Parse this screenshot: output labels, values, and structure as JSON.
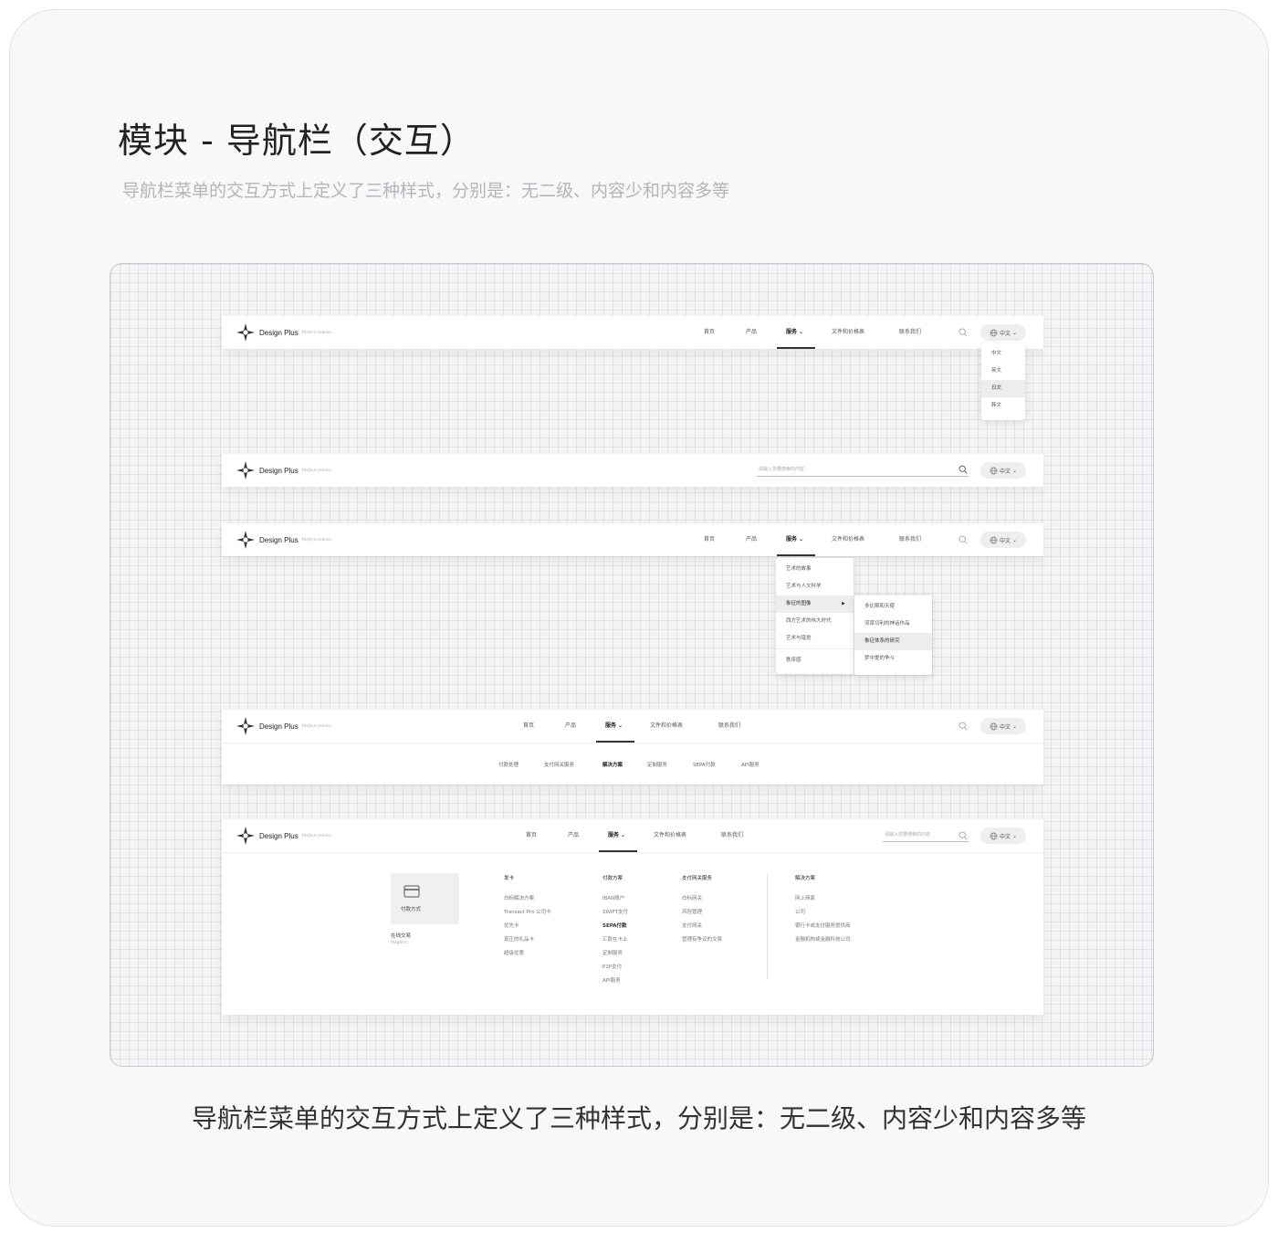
{
  "page": {
    "title": "模块 - 导航栏（交互）",
    "subtitle": "导航栏菜单的交互方式上定义了三种样式，分别是：无二级、内容少和内容多等",
    "caption": "导航栏菜单的交互方式上定义了三种样式，分别是：无二级、内容少和内容多等"
  },
  "brand": {
    "name": "Design Plus",
    "tagline": "Perfect creation"
  },
  "nav": {
    "items": [
      "首页",
      "产品",
      "服务",
      "文件和价格表",
      "联系我们"
    ],
    "lang": "中文",
    "search_placeholder": "请输入您要搜索的内容"
  },
  "lang_menu": [
    "中文",
    "英文",
    "日文",
    "韩文"
  ],
  "service_menu": [
    "艺术的故事",
    "艺术与人文科学",
    "象征的图像",
    "西方艺术的伟大时代",
    "艺术与错觉",
    "秩序感"
  ],
  "service_submenu": [
    "多比斯和天使",
    "流草切利的神话作品",
    "象征体系的研究",
    "梦中爱的争斗"
  ],
  "sub_tabs": [
    "付款处理",
    "支付网关服务",
    "解决方案",
    "定制服务",
    "SEPA付款",
    "API服务"
  ],
  "mega": {
    "card_label": "付款方式",
    "online_title": "在线交易",
    "online_sub": "Magtern",
    "columns": [
      {
        "title": "发卡",
        "links": [
          "白标解决方案",
          "Transact Pro 公司卡",
          "优先卡",
          "真正的礼品卡",
          "超级优惠"
        ]
      },
      {
        "title": "付款方案",
        "links": [
          "IBAN账户",
          "SWIFT支付",
          "SEPA付款",
          "汇款在卡上",
          "定制服务",
          "P2P支付",
          "API服务"
        ]
      },
      {
        "title": "支付网关服务",
        "links": [
          "白标网关",
          "风险管理",
          "支付网关",
          "管理有争议的交易"
        ]
      },
      {
        "title": "解决方案",
        "links": [
          "网上商家",
          "公司",
          "银行卡或支付服务提供商",
          "金融机构或金融科技公司"
        ]
      }
    ]
  }
}
